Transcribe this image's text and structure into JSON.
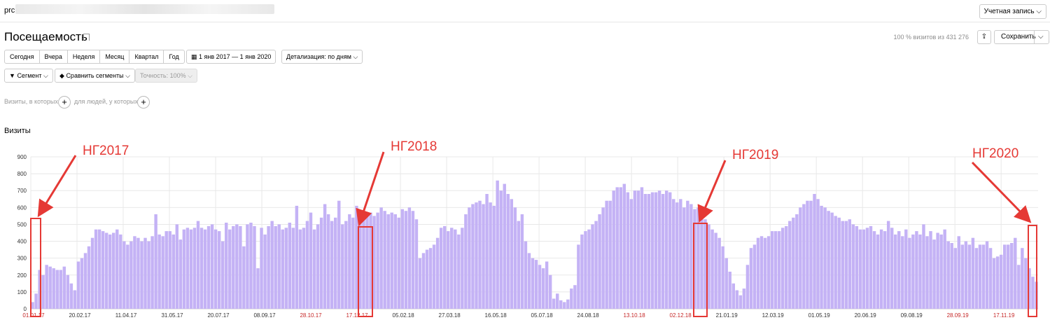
{
  "header": {
    "site": "prc",
    "account_label": "Учетная запись",
    "account_chevron": "⌵"
  },
  "title": "Посещаемость",
  "visits_stat": "100 % визитов из 431 276",
  "toolbar": {
    "export_icon": "⇪",
    "save_label": "Сохранить",
    "save_chevron": "⌵",
    "periods": [
      "Сегодня",
      "Вчера",
      "Неделя",
      "Месяц",
      "Квартал",
      "Год"
    ],
    "date_range": "1 янв 2017 — 1 янв 2020",
    "detail": "Детализация: по дням",
    "segment": "Сегмент",
    "compare": "Сравнить сегменты",
    "accuracy": "Точность: 100%"
  },
  "conditions": {
    "visits_where": "Визиты, в которых",
    "people_where": "для людей, у которых",
    "plus": "+"
  },
  "chart_title": "Визиты",
  "annotations": [
    "НГ2017",
    "НГ2018",
    "НГ2019",
    "НГ2020"
  ],
  "colors": {
    "bar": "#c4b2f5",
    "weekend_label": "#c62828",
    "annotation": "#e53935",
    "grid": "#e8e8e8"
  },
  "chart_data": {
    "type": "bar",
    "ylabel": "",
    "ylim": [
      0,
      900
    ],
    "yticks": [
      "0",
      "100",
      "200",
      "300",
      "400",
      "500",
      "600",
      "700",
      "800",
      "900"
    ],
    "xticks": [
      {
        "label": "01.01.17",
        "weekend": true
      },
      {
        "label": "20.02.17",
        "weekend": false
      },
      {
        "label": "11.04.17",
        "weekend": false
      },
      {
        "label": "31.05.17",
        "weekend": false
      },
      {
        "label": "20.07.17",
        "weekend": false
      },
      {
        "label": "08.09.17",
        "weekend": false
      },
      {
        "label": "28.10.17",
        "weekend": true
      },
      {
        "label": "17.12.17",
        "weekend": true
      },
      {
        "label": "05.02.18",
        "weekend": false
      },
      {
        "label": "27.03.18",
        "weekend": false
      },
      {
        "label": "16.05.18",
        "weekend": false
      },
      {
        "label": "05.07.18",
        "weekend": false
      },
      {
        "label": "24.08.18",
        "weekend": false
      },
      {
        "label": "13.10.18",
        "weekend": true
      },
      {
        "label": "02.12.18",
        "weekend": true
      },
      {
        "label": "21.01.19",
        "weekend": false
      },
      {
        "label": "12.03.19",
        "weekend": false
      },
      {
        "label": "01.05.19",
        "weekend": false
      },
      {
        "label": "20.06.19",
        "weekend": false
      },
      {
        "label": "09.08.19",
        "weekend": false
      },
      {
        "label": "28.09.19",
        "weekend": true
      },
      {
        "label": "17.11.19",
        "weekend": true
      }
    ],
    "series": [
      {
        "values": [
          40,
          90,
          230,
          200,
          260,
          250,
          240,
          230,
          230,
          250,
          200,
          150,
          110,
          280,
          300,
          330,
          370,
          420,
          470,
          470,
          460,
          450,
          440,
          450,
          470,
          440,
          400,
          380,
          400,
          430,
          420,
          400,
          420,
          400,
          430,
          560,
          440,
          430,
          460,
          460,
          440,
          500,
          410,
          470,
          480,
          470,
          480,
          520,
          480,
          470,
          490,
          500,
          470,
          460,
          400,
          510,
          470,
          490,
          500,
          490,
          370,
          500,
          510,
          490,
          240,
          480,
          440,
          490,
          520,
          490,
          500,
          470,
          480,
          510,
          480,
          610,
          470,
          480,
          520,
          570,
          470,
          500,
          540,
          620,
          560,
          520,
          540,
          640,
          500,
          520,
          560,
          540,
          610,
          560,
          530,
          560,
          570,
          550,
          570,
          600,
          580,
          560,
          570,
          560,
          540,
          590,
          580,
          600,
          580,
          530,
          300,
          330,
          350,
          360,
          380,
          420,
          480,
          490,
          460,
          480,
          470,
          440,
          480,
          560,
          600,
          620,
          630,
          640,
          620,
          680,
          630,
          610,
          760,
          700,
          740,
          680,
          650,
          600,
          520,
          560,
          400,
          330,
          300,
          290,
          260,
          240,
          280,
          200,
          60,
          90,
          50,
          40,
          55,
          120,
          140,
          380,
          440,
          460,
          470,
          500,
          520,
          560,
          600,
          640,
          640,
          700,
          720,
          720,
          740,
          690,
          650,
          700,
          700,
          720,
          680,
          680,
          690,
          690,
          700,
          680,
          700,
          690,
          650,
          630,
          650,
          600,
          640,
          620,
          590,
          600,
          560,
          530,
          500,
          470,
          450,
          420,
          370,
          300,
          220,
          150,
          110,
          80,
          120,
          260,
          360,
          380,
          420,
          430,
          420,
          430,
          460,
          460,
          460,
          480,
          490,
          520,
          540,
          560,
          600,
          620,
          640,
          640,
          680,
          650,
          610,
          600,
          580,
          570,
          550,
          540,
          520,
          520,
          530,
          500,
          490,
          470,
          470,
          480,
          490,
          460,
          440,
          470,
          460,
          520,
          480,
          440,
          460,
          430,
          470,
          420,
          440,
          460,
          440,
          500,
          430,
          460,
          410,
          450,
          440,
          470,
          400,
          390,
          360,
          430,
          380,
          400,
          380,
          420,
          360,
          380,
          380,
          400,
          360,
          300,
          310,
          320,
          380,
          380,
          390,
          420,
          260,
          360,
          300,
          240,
          190,
          160
        ]
      }
    ]
  }
}
